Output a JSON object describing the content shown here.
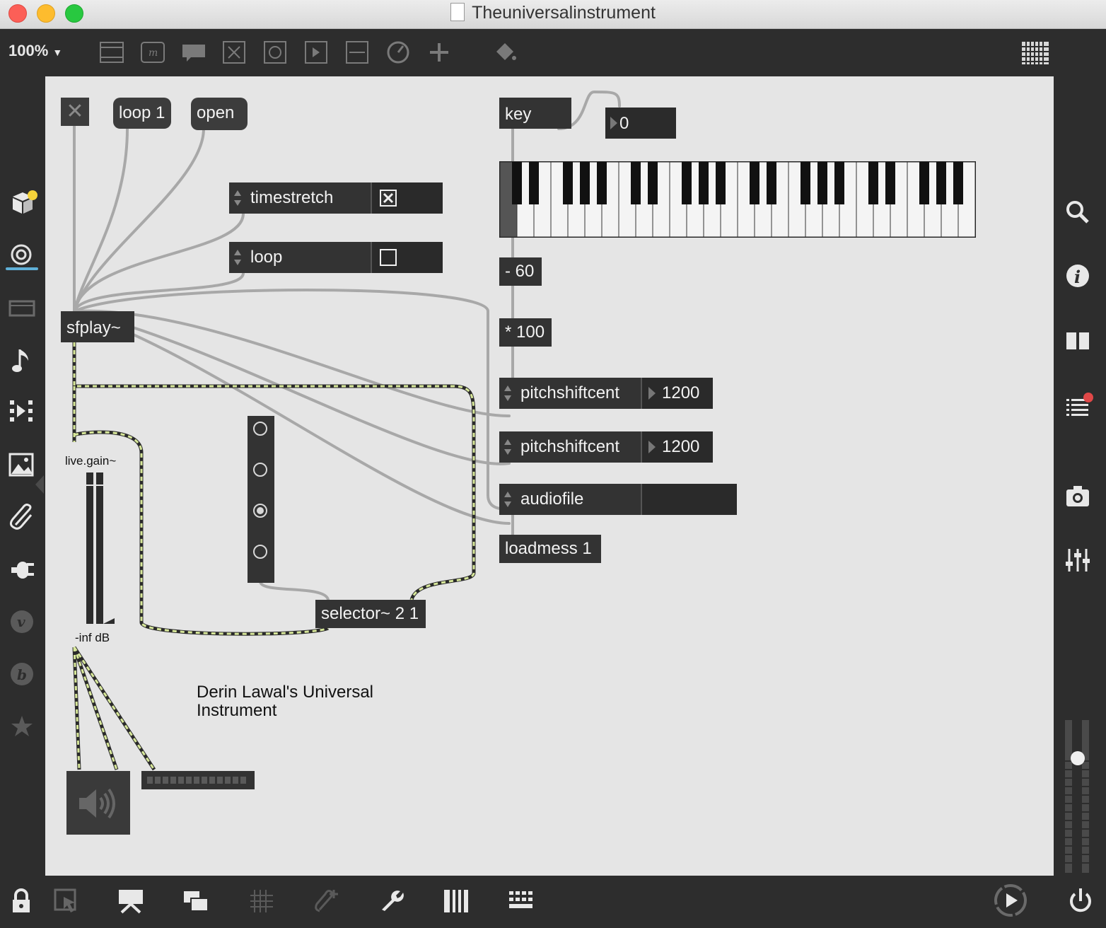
{
  "window": {
    "title": "Theuniversalinstrument"
  },
  "toolbar": {
    "zoom": "100%"
  },
  "patch": {
    "toggle_top": {
      "label": "✕"
    },
    "msg_loop1": {
      "label": "loop 1"
    },
    "msg_open": {
      "label": "open"
    },
    "attr_timestretch": {
      "label": "timestretch",
      "checked": true
    },
    "attr_loop": {
      "label": "loop",
      "checked": false
    },
    "sfplay": {
      "label": "sfplay~"
    },
    "key": {
      "label": "key"
    },
    "key_number": {
      "value": "0"
    },
    "minus60": {
      "label": "- 60"
    },
    "times100": {
      "label": "* 100"
    },
    "pitchshift1": {
      "label": "pitchshiftcent",
      "value": "1200"
    },
    "pitchshift2": {
      "label": "pitchshiftcent",
      "value": "1200"
    },
    "audiofile": {
      "label": "audiofile",
      "value": ""
    },
    "loadmess": {
      "label": "loadmess 1"
    },
    "livegain": {
      "label": "live.gain~",
      "readout": "-inf dB"
    },
    "radiogroup": {
      "options": 4,
      "selected_index": 2
    },
    "selector": {
      "label": "selector~ 2 1"
    },
    "comment": {
      "line1": "Derin Lawal's Universal",
      "line2": "Instrument"
    }
  },
  "sidebar_left": {
    "icons": [
      "package-icon",
      "inspector-record-icon",
      "clipboard-icon",
      "music-note-icon",
      "media-icon",
      "image-icon",
      "paperclip-icon",
      "plug-icon",
      "vizzie-icon",
      "bpatcher-icon",
      "star-icon"
    ]
  },
  "sidebar_right": {
    "icons": [
      "search-icon",
      "info-icon",
      "split-view-icon",
      "console-icon",
      "snapshot-icon",
      "mixer-icon"
    ]
  },
  "bottom_bar": {
    "icons": [
      "lock-icon",
      "presentation-select-icon",
      "presentation-icon",
      "windows-icon",
      "grid-icon",
      "add-clip-icon",
      "wrench-icon",
      "piano-icon",
      "keyboard-icon",
      "play-icon",
      "power-icon"
    ]
  },
  "colors": {
    "signal_wire": "#d8e89a",
    "control_wire": "#a8a8a8",
    "object_bg": "#333333",
    "canvas_bg": "#e5e5e5",
    "notify_dot": "#e04848",
    "yellow_dot": "#f5d33a"
  }
}
